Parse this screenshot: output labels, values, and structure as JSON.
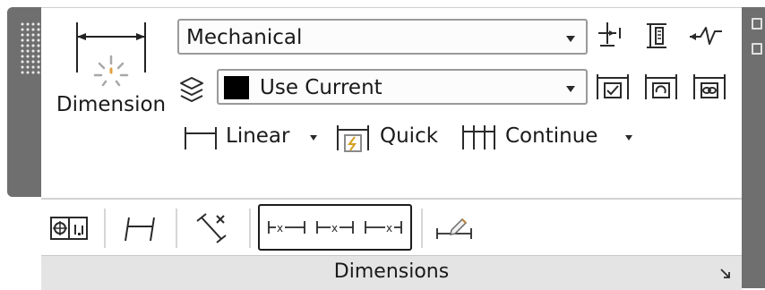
{
  "panel": {
    "title": "Dimensions",
    "launcher_icon": "dialog-launcher-arrow-icon"
  },
  "dimension_button": {
    "label": "Dimension",
    "icon": "dimension-icon"
  },
  "dim_style_combo": {
    "value": "Mechanical",
    "icon": "chevron-down-icon"
  },
  "layer_combo": {
    "value": "Use Current",
    "swatch_color": "#000000",
    "icon": "layers-icon"
  },
  "row_tools": [
    {
      "label": "Linear",
      "icon": "linear-dimension-icon",
      "has_dropdown": true
    },
    {
      "label": "Quick",
      "icon": "quick-dimension-icon",
      "has_dropdown": false
    },
    {
      "label": "Continue",
      "icon": "continue-dimension-icon",
      "has_dropdown": true
    }
  ],
  "right_icons_row1": [
    "dimension-break-icon",
    "adjust-space-icon",
    "jogged-linear-icon"
  ],
  "right_icons_row2": [
    "inspect-icon",
    "update-icon",
    "reassociate-icon"
  ],
  "slideout_icons": [
    "tolerance-icon",
    "oblique-icon",
    "text-angle-icon",
    "justify-left-icon",
    "justify-center-icon",
    "justify-right-icon",
    "override-icon"
  ],
  "accent_colors": {
    "frame": "#6f6f6f",
    "footer": "#e4e4e4"
  }
}
